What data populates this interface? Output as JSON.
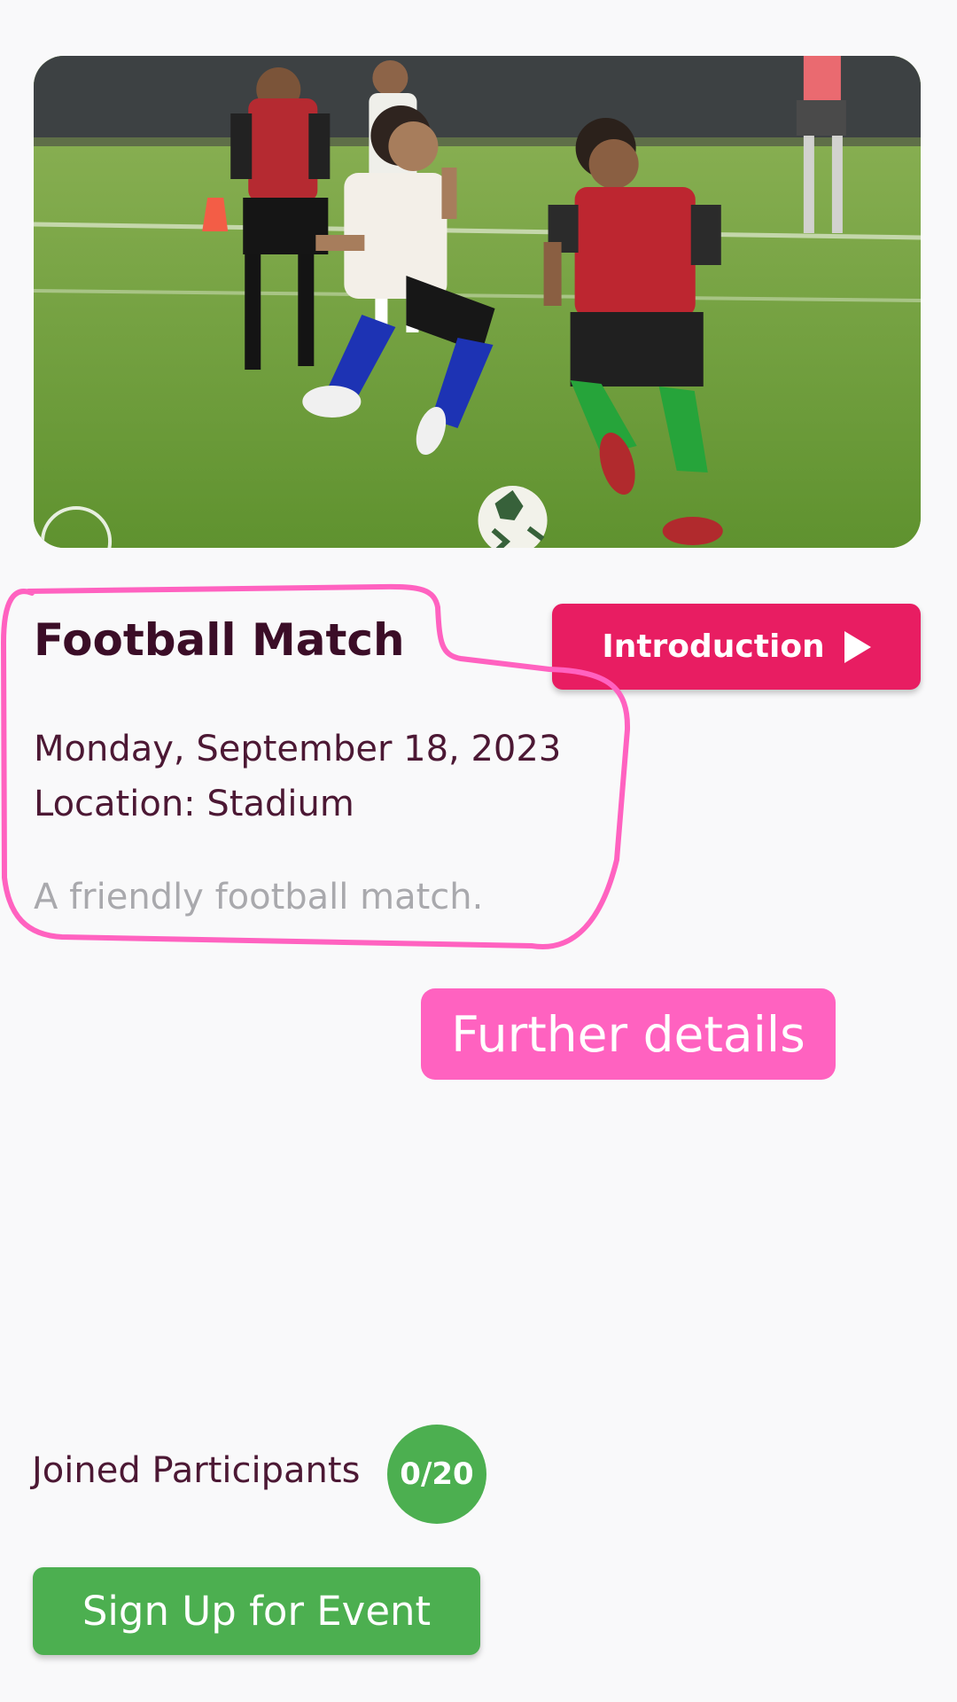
{
  "hero": {
    "image": "youth-football-action-photo"
  },
  "event": {
    "title": "Football Match",
    "date": "Monday, September 18, 2023",
    "location": "Location: Stadium",
    "description": "A friendly football match."
  },
  "introduction_button": {
    "label": "Introduction",
    "icon": "play-icon"
  },
  "annotation": {
    "label": "Further details",
    "color": "#ff62c0"
  },
  "participants": {
    "label": "Joined Participants",
    "count": "0/20"
  },
  "signup_button": {
    "label": "Sign Up for Event"
  },
  "colors": {
    "accent": "#e81d62",
    "success": "#4caf50",
    "title": "#3b0d27",
    "background": "#f9f9fa"
  }
}
